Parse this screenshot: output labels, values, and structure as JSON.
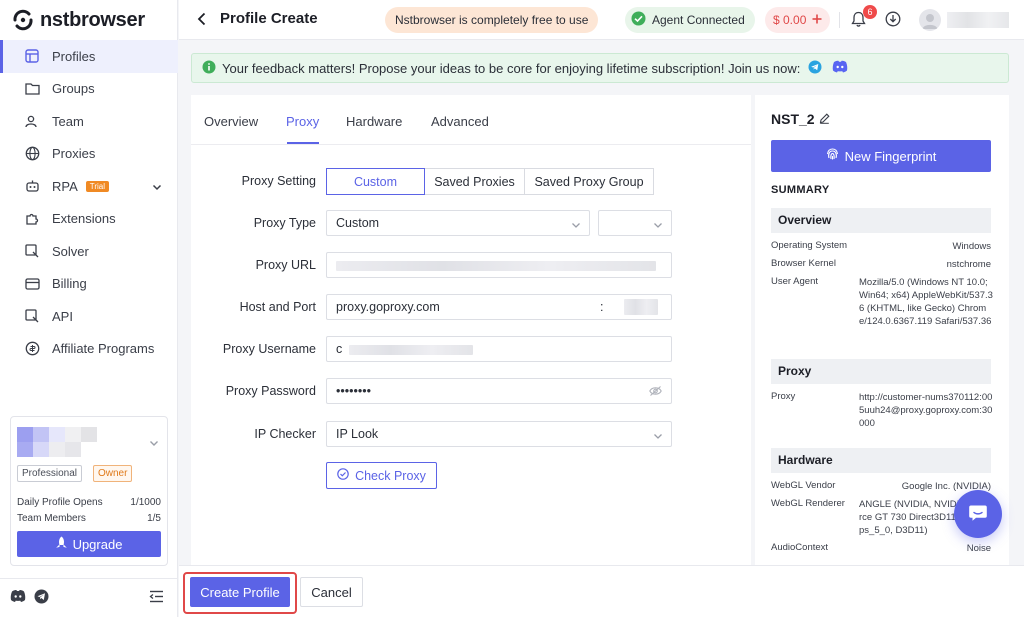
{
  "brand": {
    "name": "nstbrowser",
    "accent": "#5b63e6"
  },
  "sidebar": {
    "items": [
      {
        "label": "Profiles",
        "icon": "profiles-icon",
        "active": true
      },
      {
        "label": "Groups",
        "icon": "folder-icon"
      },
      {
        "label": "Team",
        "icon": "team-icon"
      },
      {
        "label": "Proxies",
        "icon": "globe-icon"
      },
      {
        "label": "RPA",
        "icon": "rpa-icon",
        "badge": "Trial"
      },
      {
        "label": "Extensions",
        "icon": "puzzle-icon"
      },
      {
        "label": "Solver",
        "icon": "solver-icon"
      },
      {
        "label": "Billing",
        "icon": "card-icon"
      },
      {
        "label": "API",
        "icon": "api-icon"
      },
      {
        "label": "Affiliate Programs",
        "icon": "affiliate-icon"
      }
    ],
    "account": {
      "plan_tag": "Professional",
      "role_tag": "Owner",
      "daily_opens_label": "Daily Profile Opens",
      "daily_opens_value": "1/1000",
      "team_members_label": "Team Members",
      "team_members_value": "1/5",
      "upgrade_label": "Upgrade"
    }
  },
  "header": {
    "title": "Profile Create",
    "free_notice": "Nstbrowser is completely free to use",
    "agent_status": "Agent Connected",
    "balance": "$ 0.00",
    "notification_count": "6"
  },
  "banner": {
    "text": "Your feedback matters! Propose your ideas to be core for enjoying lifetime subscription! Join us now:"
  },
  "tabs": [
    "Overview",
    "Proxy",
    "Hardware",
    "Advanced"
  ],
  "form": {
    "proxy_setting_label": "Proxy Setting",
    "proxy_setting_options": [
      "Custom",
      "Saved Proxies",
      "Saved Proxy Group"
    ],
    "proxy_type_label": "Proxy Type",
    "proxy_type_value": "Custom",
    "proxy_url_label": "Proxy URL",
    "host_port_label": "Host and Port",
    "host_value": "proxy.goproxy.com",
    "port_separator": ":",
    "username_label": "Proxy Username",
    "username_value": "c",
    "password_label": "Proxy Password",
    "password_value": "••••••••",
    "ip_checker_label": "IP Checker",
    "ip_checker_value": "IP Look",
    "check_proxy_label": "Check Proxy"
  },
  "summary": {
    "profile_name": "NST_2",
    "new_fingerprint_label": "New Fingerprint",
    "summary_label": "SUMMARY",
    "overview_head": "Overview",
    "os_label": "Operating System",
    "os_value": "Windows",
    "kernel_label": "Browser Kernel",
    "kernel_value": "nstchrome",
    "ua_label": "User Agent",
    "ua_value": "Mozilla/5.0 (Windows NT 10.0; Win64; x64) AppleWebKit/537.36 (KHTML, like Gecko) Chrome/124.0.6367.119 Safari/537.36",
    "proxy_head": "Proxy",
    "proxy_label": "Proxy",
    "proxy_value": "http://customer-nums370112:005uuh24@proxy.goproxy.com:30000",
    "hardware_head": "Hardware",
    "webgl_vendor_label": "WebGL Vendor",
    "webgl_vendor_value": "Google Inc. (NVIDIA)",
    "webgl_renderer_label": "WebGL Renderer",
    "webgl_renderer_value": "ANGLE (NVIDIA, NVIDIA GeForce GT 730 Direct3D11 vs_5_0 ps_5_0, D3D11)",
    "audio_label": "AudioContext",
    "audio_value": "Noise"
  },
  "footer": {
    "create_label": "Create Profile",
    "cancel_label": "Cancel"
  }
}
